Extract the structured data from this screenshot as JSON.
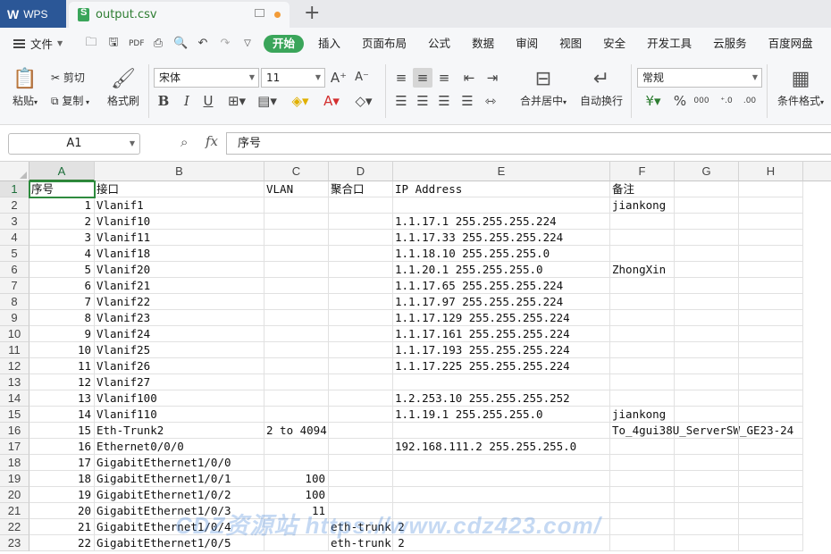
{
  "titlebar": {
    "app_name": "WPS",
    "file_tab": "output.csv",
    "new_tab_symbol": "+"
  },
  "menubar": {
    "file_label": "文件",
    "tabs": [
      "开始",
      "插入",
      "页面布局",
      "公式",
      "数据",
      "审阅",
      "视图",
      "安全",
      "开发工具",
      "云服务",
      "百度网盘"
    ],
    "active_tab": "开始"
  },
  "ribbon": {
    "paste": "粘贴",
    "cut": "剪切",
    "copy": "复制",
    "format_painter": "格式刷",
    "font_name": "宋体",
    "font_size": "11",
    "merge_center": "合并居中",
    "wrap_text": "自动换行",
    "number_format": "常规",
    "conditional_format": "条件格式",
    "percent_symbol": "%",
    "thousands_symbol": "000"
  },
  "formula_bar": {
    "name_box": "A1",
    "fx_label": "fx",
    "content": "序号"
  },
  "columns": [
    "A",
    "B",
    "C",
    "D",
    "E",
    "F",
    "G",
    "H"
  ],
  "rows": [
    {
      "n": "1",
      "A": "序号",
      "B": "接口",
      "C": "VLAN",
      "D": "聚合口",
      "E": "IP Address",
      "F": "备注"
    },
    {
      "n": "2",
      "A": "1",
      "B": "Vlanif1",
      "C": "",
      "D": "",
      "E": "",
      "F": "jiankong"
    },
    {
      "n": "3",
      "A": "2",
      "B": "Vlanif10",
      "C": "",
      "D": "",
      "E": "1.1.17.1 255.255.255.224",
      "F": ""
    },
    {
      "n": "4",
      "A": "3",
      "B": "Vlanif11",
      "C": "",
      "D": "",
      "E": "1.1.17.33 255.255.255.224",
      "F": ""
    },
    {
      "n": "5",
      "A": "4",
      "B": "Vlanif18",
      "C": "",
      "D": "",
      "E": "1.1.18.10 255.255.255.0",
      "F": ""
    },
    {
      "n": "6",
      "A": "5",
      "B": "Vlanif20",
      "C": "",
      "D": "",
      "E": "1.1.20.1 255.255.255.0",
      "F": "ZhongXin"
    },
    {
      "n": "7",
      "A": "6",
      "B": "Vlanif21",
      "C": "",
      "D": "",
      "E": "1.1.17.65 255.255.255.224",
      "F": ""
    },
    {
      "n": "8",
      "A": "7",
      "B": "Vlanif22",
      "C": "",
      "D": "",
      "E": "1.1.17.97 255.255.255.224",
      "F": ""
    },
    {
      "n": "9",
      "A": "8",
      "B": "Vlanif23",
      "C": "",
      "D": "",
      "E": "1.1.17.129 255.255.255.224",
      "F": ""
    },
    {
      "n": "10",
      "A": "9",
      "B": "Vlanif24",
      "C": "",
      "D": "",
      "E": "1.1.17.161 255.255.255.224",
      "F": ""
    },
    {
      "n": "11",
      "A": "10",
      "B": "Vlanif25",
      "C": "",
      "D": "",
      "E": "1.1.17.193 255.255.255.224",
      "F": ""
    },
    {
      "n": "12",
      "A": "11",
      "B": "Vlanif26",
      "C": "",
      "D": "",
      "E": "1.1.17.225 255.255.255.224",
      "F": ""
    },
    {
      "n": "13",
      "A": "12",
      "B": "Vlanif27",
      "C": "",
      "D": "",
      "E": "",
      "F": ""
    },
    {
      "n": "14",
      "A": "13",
      "B": "Vlanif100",
      "C": "",
      "D": "",
      "E": "1.2.253.10 255.255.255.252",
      "F": ""
    },
    {
      "n": "15",
      "A": "14",
      "B": "Vlanif110",
      "C": "",
      "D": "",
      "E": "1.1.19.1 255.255.255.0",
      "F": "jiankong"
    },
    {
      "n": "16",
      "A": "15",
      "B": "Eth-Trunk2",
      "C": "2 to 4094",
      "D": "",
      "E": "",
      "F": "To_4gui38U_ServerSW_GE23-24"
    },
    {
      "n": "17",
      "A": "16",
      "B": "Ethernet0/0/0",
      "C": "",
      "D": "",
      "E": "192.168.111.2 255.255.255.0",
      "F": ""
    },
    {
      "n": "18",
      "A": "17",
      "B": "GigabitEthernet1/0/0",
      "C": "",
      "D": "",
      "E": "",
      "F": ""
    },
    {
      "n": "19",
      "A": "18",
      "B": "GigabitEthernet1/0/1",
      "C": "100",
      "D": "",
      "E": "",
      "F": ""
    },
    {
      "n": "20",
      "A": "19",
      "B": "GigabitEthernet1/0/2",
      "C": "100",
      "D": "",
      "E": "",
      "F": ""
    },
    {
      "n": "21",
      "A": "20",
      "B": "GigabitEthernet1/0/3",
      "C": "11",
      "D": "",
      "E": "",
      "F": ""
    },
    {
      "n": "22",
      "A": "21",
      "B": "GigabitEthernet1/0/4",
      "C": "",
      "D": "eth-trunk 2",
      "E": "",
      "F": ""
    },
    {
      "n": "23",
      "A": "22",
      "B": "GigabitEthernet1/0/5",
      "C": "",
      "D": "eth-trunk 2",
      "E": "",
      "F": ""
    }
  ],
  "watermark": "CDZ资源站 https://www.cdz423.com/",
  "colors": {
    "accent": "#3aa55a",
    "selection": "#2e8b3e",
    "wps_blue": "#2b5797"
  }
}
